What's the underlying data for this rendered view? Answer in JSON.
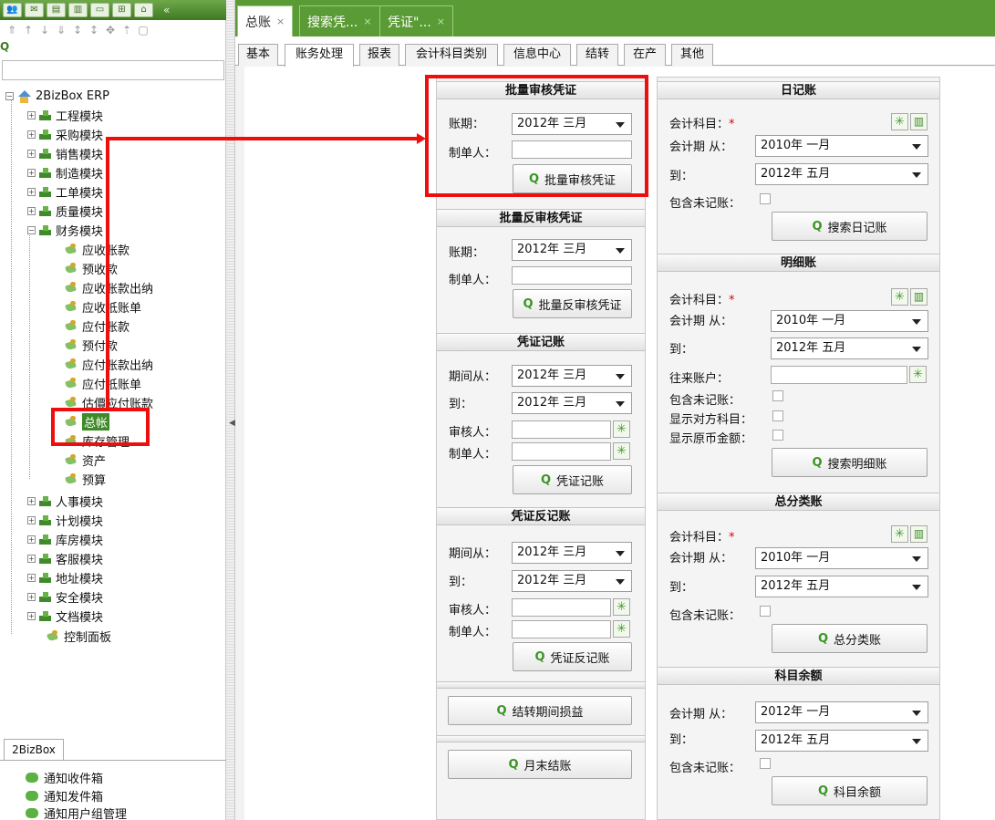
{
  "sidebar": {
    "toolbar_icons": [
      "users-icon",
      "mail-icon",
      "document-icon",
      "chart-icon",
      "window-icon",
      "org-icon",
      "home-icon"
    ],
    "tree": {
      "root": "2BizBox ERP",
      "modules": [
        "工程模块",
        "采购模块",
        "销售模块",
        "制造模块",
        "工单模块",
        "质量模块",
        "财务模块"
      ],
      "finance_children": [
        "应收账款",
        "预收款",
        "应收账款出纳",
        "应收抵账单",
        "应付账款",
        "预付款",
        "应付账款出纳",
        "应付抵账单",
        "估價应付账款",
        "总帐",
        "库存管理",
        "资产",
        "预算"
      ],
      "modules_after": [
        "人事模块",
        "计划模块",
        "库房模块",
        "客服模块",
        "地址模块",
        "安全模块",
        "文档模块"
      ],
      "control_panel": "控制面板"
    },
    "bottom_tab": "2BizBox",
    "notifications": [
      "通知收件箱",
      "通知发件箱",
      "通知用户组管理"
    ]
  },
  "doc_tabs": [
    {
      "label": "总账",
      "close": "×"
    },
    {
      "label": "搜索凭...",
      "close": "×"
    },
    {
      "label": "凭证\"...",
      "close": "×"
    }
  ],
  "sub_tabs": [
    "基本",
    "账务处理",
    "报表",
    "会计科目类别",
    "信息中心",
    "结转",
    "在产",
    "其他"
  ],
  "left_col": {
    "batch_audit": {
      "title": "批量审核凭证",
      "period_label": "账期：",
      "period_value": "2012年 三月",
      "maker_label": "制单人：",
      "button": "批量审核凭证"
    },
    "batch_unaudit": {
      "title": "批量反审核凭证",
      "period_label": "账期：",
      "period_value": "2012年 三月",
      "maker_label": "制单人：",
      "button": "批量反审核凭证"
    },
    "post": {
      "title": "凭证记账",
      "from_label": "期间从：",
      "from_value": "2012年 三月",
      "to_label": "到：",
      "to_value": "2012年 三月",
      "auditor_label": "审核人：",
      "maker_label": "制单人：",
      "button": "凭证记账"
    },
    "unpost": {
      "title": "凭证反记账",
      "from_label": "期间从：",
      "from_value": "2012年 三月",
      "to_label": "到：",
      "to_value": "2012年 三月",
      "auditor_label": "审核人：",
      "maker_label": "制单人：",
      "button": "凭证反记账"
    },
    "transfer_button": "结转期间损益",
    "month_end_button": "月末结账"
  },
  "right_col": {
    "journal": {
      "title": "日记账",
      "account_label": "会计科目：",
      "from_label": "会计期 从：",
      "from_value": "2010年 一月",
      "to_label": "到：",
      "to_value": "2012年 五月",
      "unposted_label": "包含未记账：",
      "button": "搜索日记账"
    },
    "detail": {
      "title": "明细账",
      "account_label": "会计科目：",
      "from_label": "会计期 从：",
      "from_value": "2010年 一月",
      "to_label": "到：",
      "to_value": "2012年 五月",
      "partner_label": "往来账户：",
      "unposted_label": "包含未记账：",
      "counter_label": "显示对方科目：",
      "orig_label": "显示原币金额：",
      "button": "搜索明细账"
    },
    "ledger": {
      "title": "总分类账",
      "account_label": "会计科目：",
      "from_label": "会计期 从：",
      "from_value": "2010年 一月",
      "to_label": "到：",
      "to_value": "2012年 五月",
      "unposted_label": "包含未记账：",
      "button": "总分类账"
    },
    "balance": {
      "title": "科目余额",
      "from_label": "会计期 从：",
      "from_value": "2012年 一月",
      "to_label": "到：",
      "to_value": "2012年 五月",
      "unposted_label": "包含未记账：",
      "button": "科目余额"
    }
  },
  "required_mark": "*",
  "colors": {
    "brand_green": "#5b9b35",
    "annotation_red": "#ee0e0e",
    "selected_bg": "#3f8a28"
  }
}
